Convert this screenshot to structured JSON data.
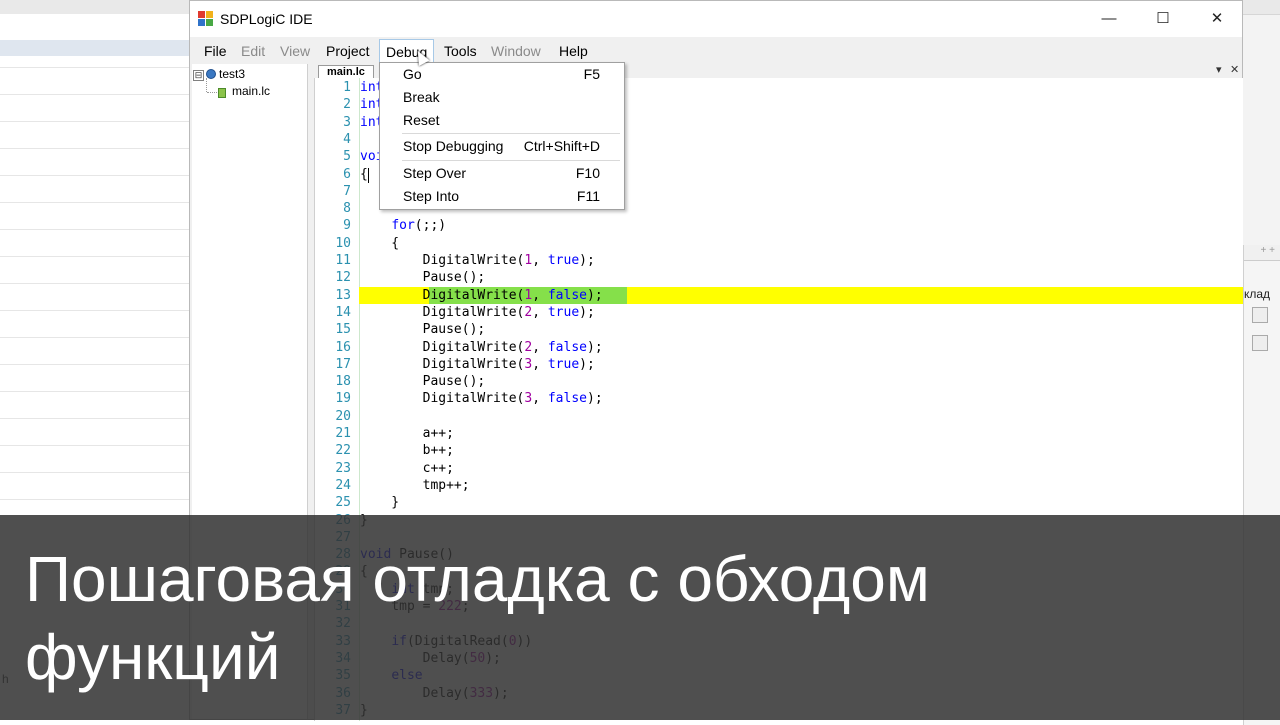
{
  "window": {
    "title": "SDPLogiC IDE",
    "minimize": "—",
    "maximize": "☐",
    "close": "✕"
  },
  "menu": {
    "file": "File",
    "edit": "Edit",
    "view": "View",
    "project": "Project",
    "debug": "Debug",
    "tools": "Tools",
    "window": "Window",
    "help": "Help"
  },
  "debug_menu": {
    "go": {
      "label": "Go",
      "key": "F5"
    },
    "break": {
      "label": "Break",
      "key": ""
    },
    "reset": {
      "label": "Reset",
      "key": ""
    },
    "stop": {
      "label": "Stop Debugging",
      "key": "Ctrl+Shift+D"
    },
    "step_over": {
      "label": "Step Over",
      "key": "F10"
    },
    "step_into": {
      "label": "Step Into",
      "key": "F11"
    }
  },
  "tree": {
    "project": "test3",
    "file": "main.lc",
    "expander": "⊟"
  },
  "editor": {
    "tab": "main.lc",
    "tab_menu": "▾",
    "tab_close": "✕",
    "current_line": 13,
    "line_numbers": [
      "1",
      "2",
      "3",
      "4",
      "5",
      "6",
      "7",
      "8",
      "9",
      "10",
      "11",
      "12",
      "13",
      "14",
      "15",
      "16",
      "17",
      "18",
      "19",
      "20",
      "21",
      "22",
      "23",
      "24",
      "25",
      "26",
      "27",
      "28",
      "29",
      "30",
      "31",
      "32",
      "33",
      "34",
      "35",
      "36",
      "37"
    ],
    "lines": [
      "int a;",
      "int b;",
      "int c;",
      "",
      "void main()",
      "{",
      "",
      "",
      "    for(;;)",
      "    {",
      "        DigitalWrite(1, true);",
      "        Pause();",
      "        DigitalWrite(1, false);",
      "        DigitalWrite(2, true);",
      "        Pause();",
      "        DigitalWrite(2, false);",
      "        DigitalWrite(3, true);",
      "        Pause();",
      "        DigitalWrite(3, false);",
      "",
      "        a++;",
      "        b++;",
      "        c++;",
      "        tmp++;",
      "    }",
      "}",
      "",
      "void Pause()",
      "{",
      "    int tmp;",
      "    tmp = 222;",
      "",
      "    if(DigitalRead(0))",
      "        Delay(50);",
      "    else",
      "        Delay(333);",
      "}"
    ]
  },
  "background": {
    "right_tab_text": "клад",
    "left_text": "h",
    "plus": "+ +"
  },
  "caption": {
    "text": "Пошаговая отладка с обходом\nфункций"
  }
}
